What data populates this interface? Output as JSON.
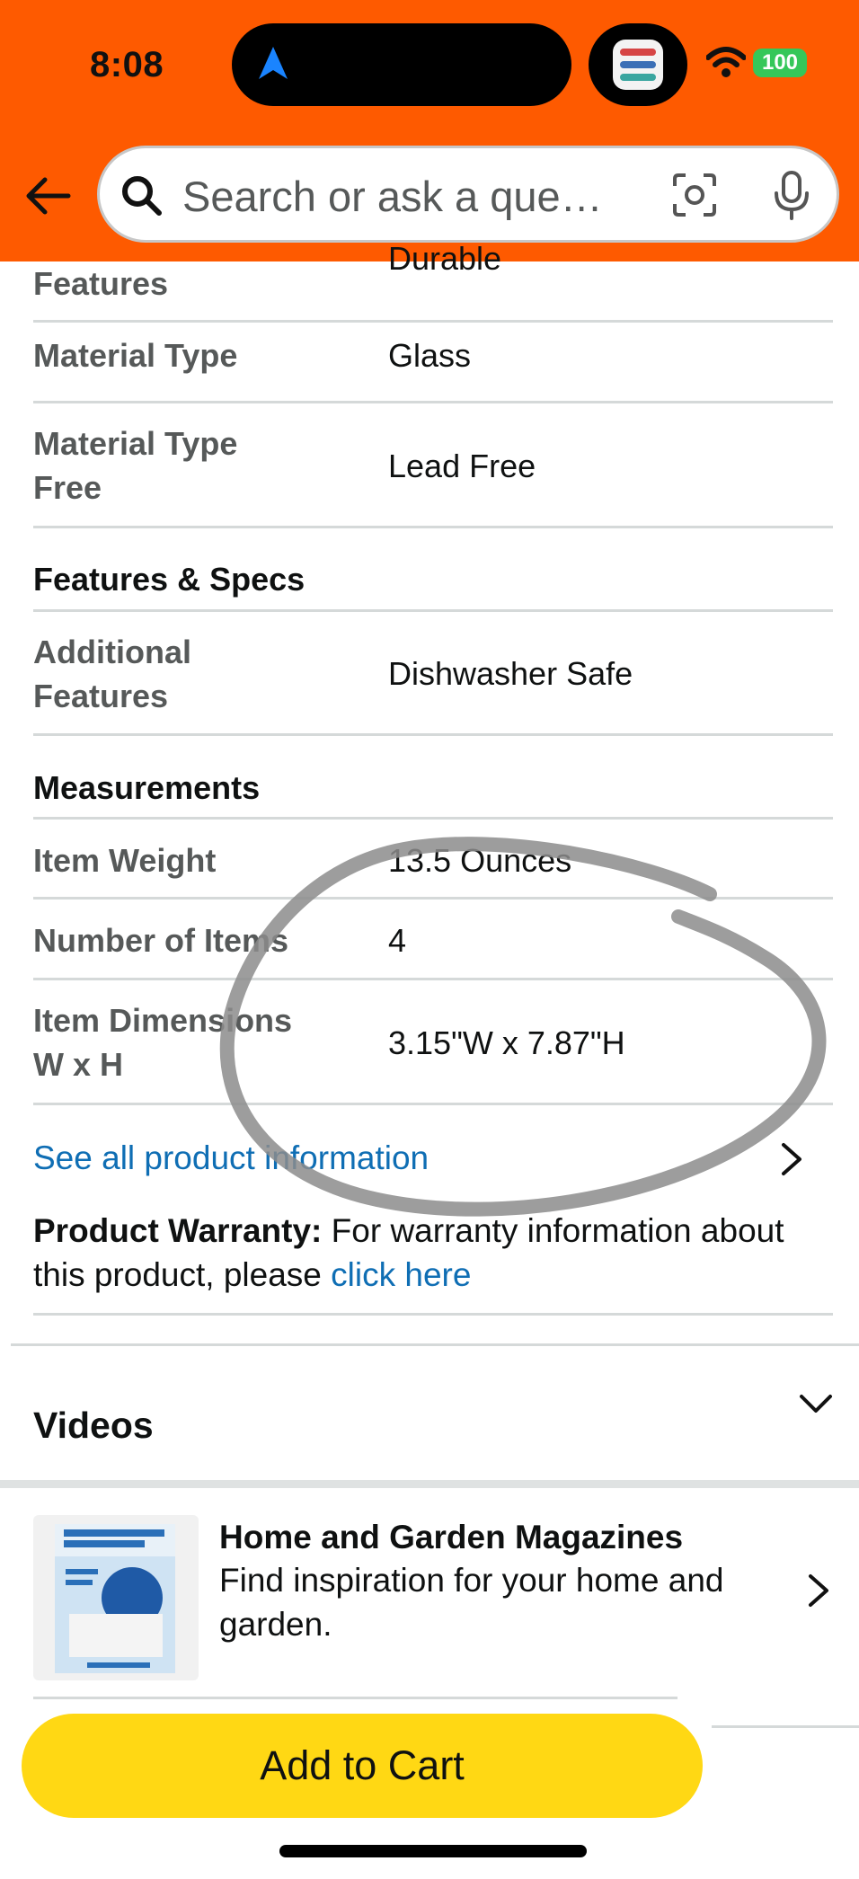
{
  "status_bar": {
    "time": "8:08",
    "battery": "100",
    "icons": [
      "navigation-arrow-icon",
      "app-icon",
      "wifi-icon",
      "battery-icon"
    ]
  },
  "search": {
    "placeholder": "Search or ask a que…",
    "icons": [
      "back-arrow-icon",
      "search-icon",
      "camera-lens-icon",
      "microphone-icon"
    ]
  },
  "specs": {
    "cutoff_value": "Durable",
    "cutoff_label": "Features",
    "rows_group1": [
      {
        "label": "Material Type",
        "value": "Glass"
      },
      {
        "label_line1": "Material Type",
        "label_line2": "Free",
        "value": "Lead Free"
      }
    ],
    "section_features": "Features & Specs",
    "additional": {
      "label_line1": "Additional",
      "label_line2": "Features",
      "value": "Dishwasher Safe"
    },
    "section_measurements": "Measurements",
    "item_weight": {
      "label": "Item Weight",
      "value": "13.5 Ounces"
    },
    "number_of_items": {
      "label": "Number of Items",
      "value": "4"
    },
    "dimensions": {
      "label_line1": "Item Dimensions",
      "label_line2": "W x H",
      "value": "3.15\"W x 7.87\"H"
    }
  },
  "links": {
    "see_all": "See all product information"
  },
  "warranty": {
    "bold": "Product Warranty:",
    "text": " For warranty information about this product, please ",
    "link": "click here"
  },
  "videos": {
    "title": "Videos"
  },
  "ad": {
    "title": "Home and Garden Magazines",
    "description": "Find inspiration for your home and garden."
  },
  "cart": {
    "label": "Add to Cart"
  },
  "colors": {
    "header": "#fe5a00",
    "link": "#0f6eb4",
    "cart_button": "#ffd814",
    "battery": "#35c759",
    "annotation_stroke": "#8c8c8c"
  }
}
